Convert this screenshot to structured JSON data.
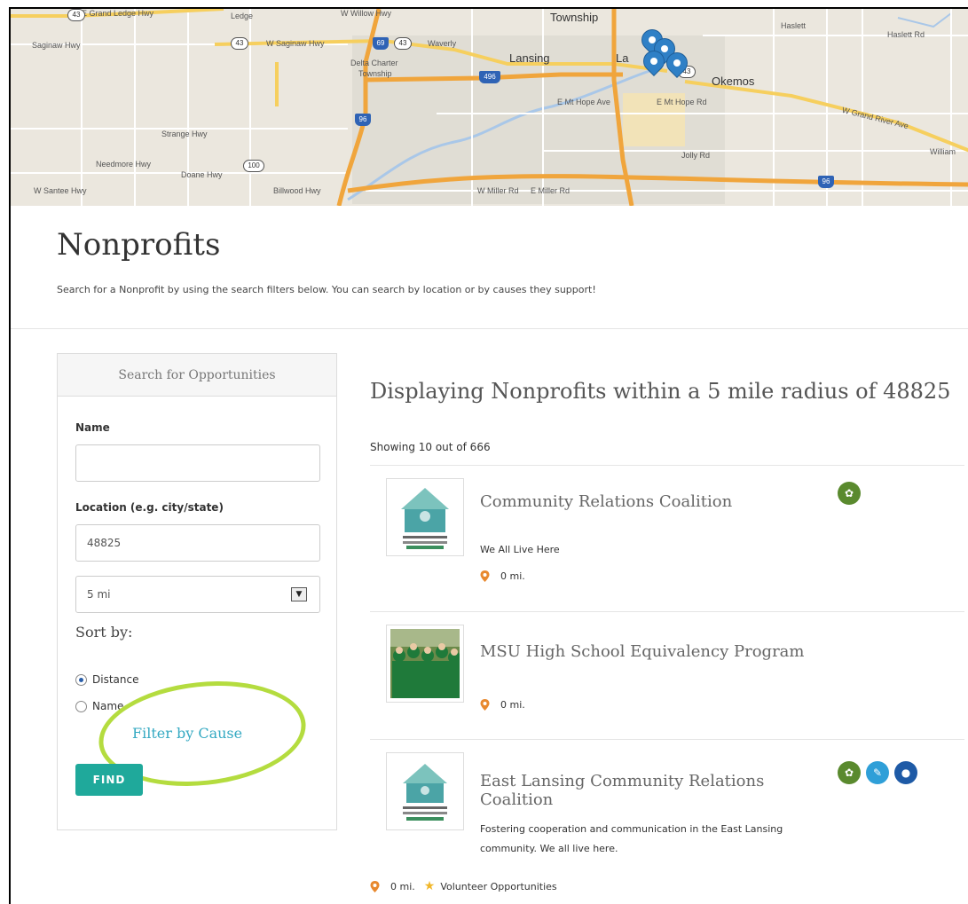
{
  "map": {
    "labels": {
      "township": "Township",
      "haslett": "Haslett",
      "haslett_rd": "Haslett Rd",
      "saginaw_hwy": "Saginaw Hwy",
      "w_saginaw_hwy": "W Saginaw Hwy",
      "waverly": "Waverly",
      "lansing": "Lansing",
      "delta_charter": "Delta Charter",
      "delta_township": "Township",
      "okemos": "Okemos",
      "e_mt_hope_ave": "E Mt Hope Ave",
      "e_mt_hope_rd": "E Mt Hope Rd",
      "w_grand_river": "W Grand River Ave",
      "william": "William",
      "strange_hwy": "Strange Hwy",
      "needmore_hwy": "Needmore Hwy",
      "doane_hwy": "Doane Hwy",
      "jolly_rd": "Jolly Rd",
      "w_santee_hwy": "W Santee Hwy",
      "billwood_hwy": "Billwood Hwy",
      "w_miller_rd": "W Miller Rd",
      "e_miller_rd": "E Miller Rd",
      "ledge": "Ledge",
      "la": "La",
      "w_willow_hwy": "W Willow Hwy",
      "e_grand_ledge_hwy": "E Grand Ledge Hwy"
    },
    "shields": {
      "r43a": "43",
      "r43b": "43",
      "r43c": "43",
      "r43d": "43",
      "r100": "100"
    },
    "interstates": {
      "i69": "69",
      "i496": "496",
      "i96a": "96",
      "i96b": "96"
    }
  },
  "header": {
    "title": "Nonprofits",
    "subtitle": "Search for a Nonprofit by using the search filters below. You can search by location or by causes they support!"
  },
  "sidebar": {
    "heading": "Search for Opportunities",
    "name_label": "Name",
    "name_value": "",
    "location_label": "Location (e.g. city/state)",
    "location_value": "48825",
    "radius_value": "5 mi",
    "sort_label": "Sort by:",
    "sort_distance": "Distance",
    "sort_name": "Name",
    "filter_by_cause": "Filter by Cause",
    "find_button": "FIND"
  },
  "results": {
    "title": "Displaying Nonprofits within a 5 mile radius of 48825",
    "count": "Showing 10 out of 666",
    "items": [
      {
        "name": "Community Relations Coalition",
        "description": "We All Live Here",
        "distance": "0 mi."
      },
      {
        "name": "MSU High School Equivalency Program",
        "description": "",
        "distance": "0 mi."
      },
      {
        "name": "East Lansing Community Relations Coalition",
        "description": "Fostering cooperation and communication in the East Lansing community. We all live here.",
        "distance": "0 mi.",
        "extra": "Volunteer Opportunities"
      }
    ]
  },
  "colors": {
    "accent": "#1fa99b",
    "link": "#34a9c2",
    "annotation": "#b4dc3f",
    "pin": "#e8892f"
  }
}
